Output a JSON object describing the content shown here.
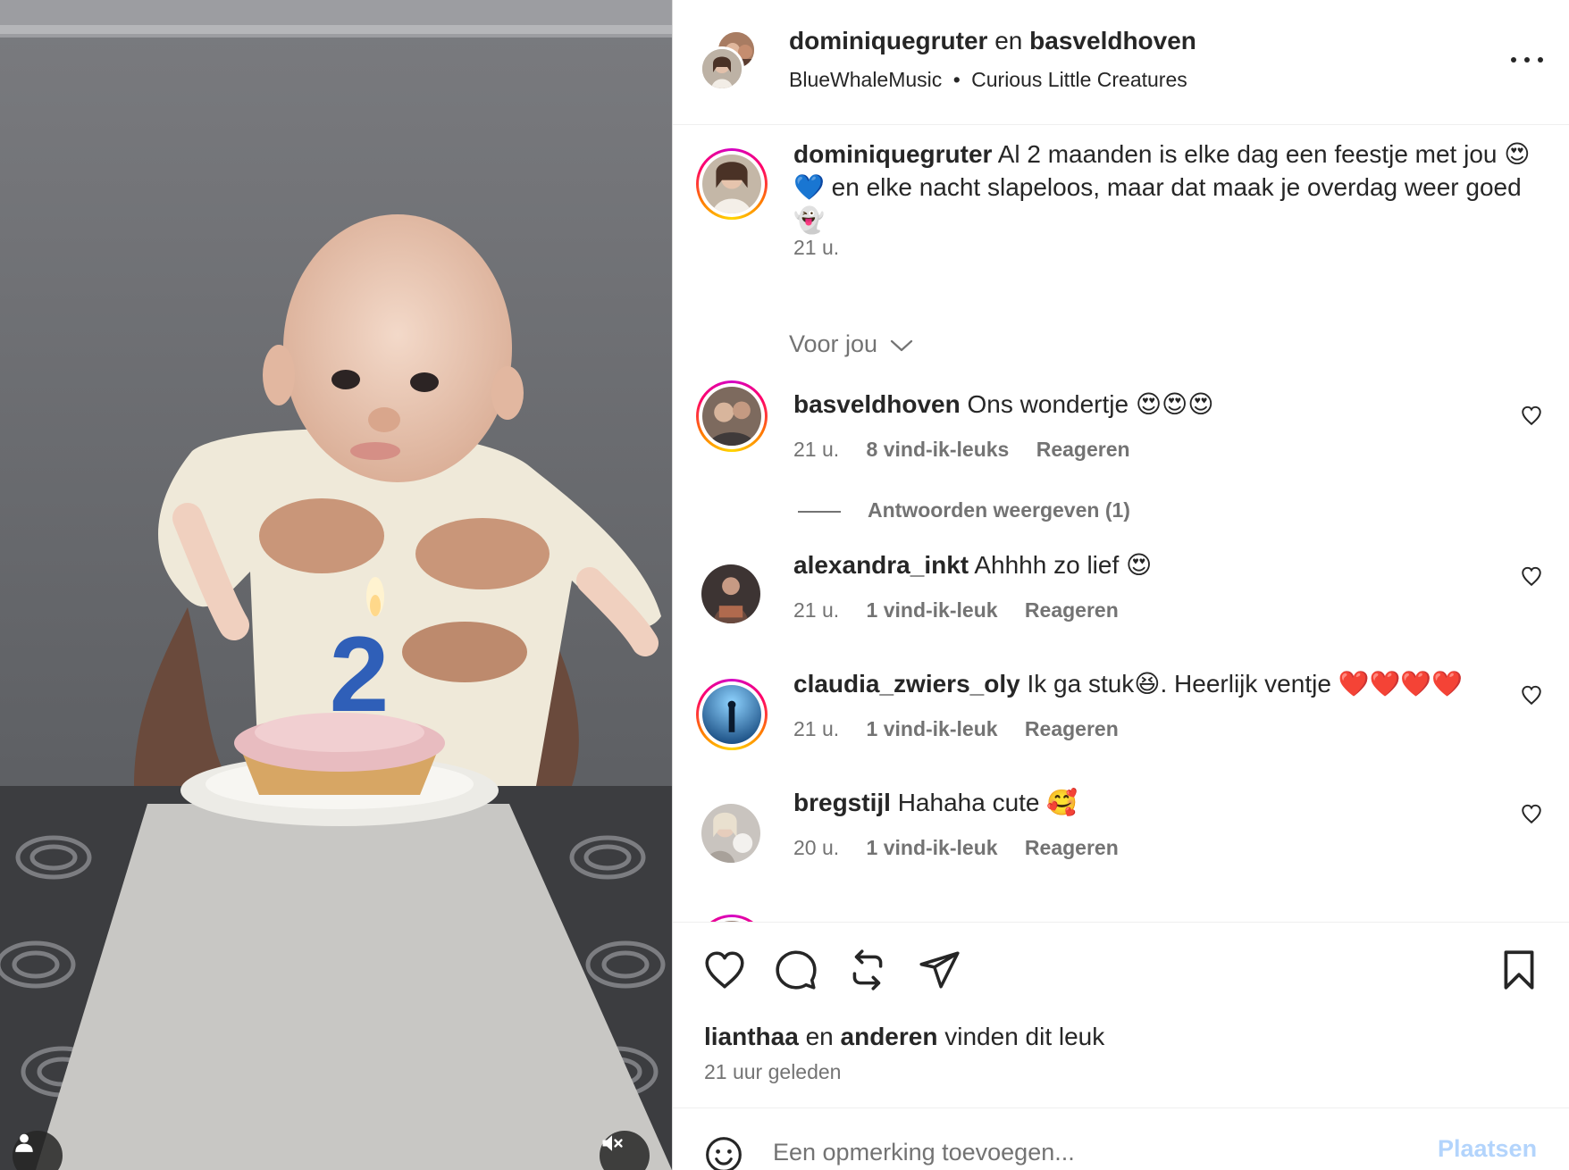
{
  "header": {
    "user1": "dominiquegruter",
    "connector": "en",
    "user2": "basveldhoven",
    "audio_artist": "BlueWhaleMusic",
    "separator": "•",
    "audio_title": "Curious Little Creatures"
  },
  "caption": {
    "username": "dominiquegruter",
    "text": "Al 2 maanden is elke dag een feestje met jou 😍💙 en elke nacht slapeloos, maar dat maak je overdag weer goed 👻",
    "time": "21 u."
  },
  "sort": {
    "label": "Voor jou"
  },
  "comments": [
    {
      "username": "basveldhoven",
      "text": "Ons wondertje 😍😍😍",
      "time": "21 u.",
      "likes": "8 vind-ik-leuks",
      "reply": "Reageren"
    },
    {
      "username": "alexandra_inkt",
      "text": "Ahhhh zo lief 😍",
      "time": "21 u.",
      "likes": "1 vind-ik-leuk",
      "reply": "Reageren"
    },
    {
      "username": "claudia_zwiers_oly",
      "text": "Ik ga stuk😆. Heerlijk ventje ❤️❤️❤️❤️",
      "time": "21 u.",
      "likes": "1 vind-ik-leuk",
      "reply": "Reageren"
    },
    {
      "username": "bregstijl",
      "text": "Hahaha cute 🥰",
      "time": "20 u.",
      "likes": "1 vind-ik-leuk",
      "reply": "Reageren"
    }
  ],
  "view_replies": "Antwoorden weergeven (1)",
  "likes_summary": {
    "user": "lianthaa",
    "connector": "en",
    "others": "anderen",
    "suffix": "vinden dit leuk"
  },
  "post_time": "21 uur geleden",
  "composer": {
    "placeholder": "Een opmerking toevoegen...",
    "post_label": "Plaatsen"
  },
  "media": {
    "candle_number": "2"
  },
  "colors": {
    "post_button_disabled": "#b3d4fc",
    "muted_text": "#737373",
    "wall": "#6b6d71"
  }
}
